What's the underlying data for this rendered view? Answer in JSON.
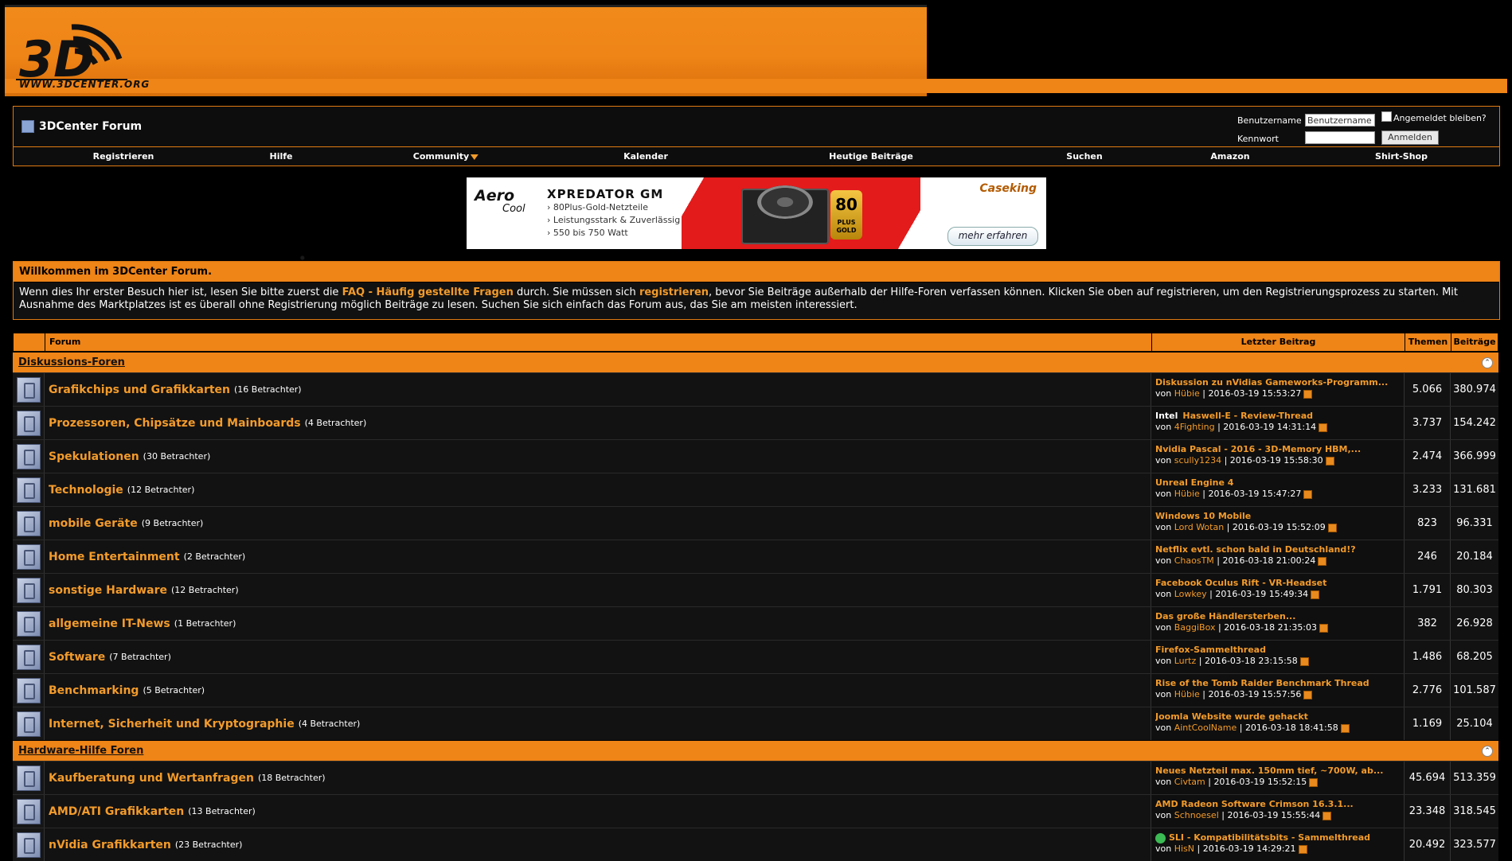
{
  "site": {
    "logo_text": "3D",
    "url": "WWW.3DCENTER.ORG",
    "title": "3DCenter Forum"
  },
  "login": {
    "username_label": "Benutzername",
    "username_placeholder": "Benutzername",
    "password_label": "Kennwort",
    "remember_label": "Angemeldet bleiben?",
    "login_button": "Anmelden"
  },
  "nav": {
    "items": [
      "Registrieren",
      "Hilfe",
      "Community",
      "Kalender",
      "Heutige Beiträge",
      "Suchen",
      "Amazon",
      "Shirt-Shop"
    ]
  },
  "banner": {
    "brand": "Aero",
    "brand2": "Cool",
    "product": "XPREDATOR GM",
    "bullets": [
      "80Plus-Gold-Netzteile",
      "Leistungsstark & Zuverlässig",
      "550 bis 750 Watt"
    ],
    "badge": "80",
    "badge_sub": "PLUS",
    "badge_sub2": "GOLD",
    "shop": "Caseking",
    "cta": "mehr erfahren"
  },
  "welcome": {
    "title": "Willkommen im 3DCenter Forum.",
    "text_1": "Wenn dies Ihr erster Besuch hier ist, lesen Sie bitte zuerst die ",
    "link_faq": "FAQ - Häufig gestellte Fragen",
    "text_2": " durch. Sie müssen sich ",
    "link_register": "registrieren",
    "text_3": ", bevor Sie Beiträge außerhalb der Hilfe-Foren verfassen können. Klicken Sie oben auf registrieren, um den Registrierungsprozess zu starten. Mit Ausnahme des Marktplatzes ist es überall ohne Registrierung möglich Beiträge zu lesen. Suchen Sie sich einfach das Forum aus, das Sie am meisten interessiert."
  },
  "table": {
    "headers": {
      "forum": "Forum",
      "last": "Letzter Beitrag",
      "threads": "Themen",
      "posts": "Beiträge"
    },
    "sections": [
      {
        "title": "Diskussions-Foren",
        "rows": [
          {
            "name": "Grafikchips und Grafikkarten",
            "viewers": "(16 Betrachter)",
            "last_title": "Diskussion zu nVidias Gameworks-Programm...",
            "prefix": "",
            "by": "von",
            "user": "Hübie",
            "date": "2016-03-19 15:53:27",
            "threads": "5.066",
            "posts": "380.974"
          },
          {
            "name": "Prozessoren, Chipsätze und Mainboards",
            "viewers": "(4 Betrachter)",
            "last_title": "Haswell-E - Review-Thread",
            "prefix": "Intel",
            "by": "von",
            "user": "4Fighting",
            "date": "2016-03-19 14:31:14",
            "threads": "3.737",
            "posts": "154.242"
          },
          {
            "name": "Spekulationen",
            "viewers": "(30 Betrachter)",
            "last_title": "Nvidia Pascal - 2016 - 3D-Memory HBM,...",
            "prefix": "",
            "by": "von",
            "user": "scully1234",
            "date": "2016-03-19 15:58:30",
            "threads": "2.474",
            "posts": "366.999"
          },
          {
            "name": "Technologie",
            "viewers": "(12 Betrachter)",
            "last_title": "Unreal Engine 4",
            "prefix": "",
            "by": "von",
            "user": "Hübie",
            "date": "2016-03-19 15:47:27",
            "threads": "3.233",
            "posts": "131.681"
          },
          {
            "name": "mobile Geräte",
            "viewers": "(9 Betrachter)",
            "last_title": "Windows 10 Mobile",
            "prefix": "",
            "by": "von",
            "user": "Lord Wotan",
            "date": "2016-03-19 15:52:09",
            "threads": "823",
            "posts": "96.331"
          },
          {
            "name": "Home Entertainment",
            "viewers": "(2 Betrachter)",
            "last_title": "Netflix evtl. schon bald in Deutschland!?",
            "prefix": "",
            "by": "von",
            "user": "ChaosTM",
            "date": "2016-03-18 21:00:24",
            "threads": "246",
            "posts": "20.184"
          },
          {
            "name": "sonstige Hardware",
            "viewers": "(12 Betrachter)",
            "last_title": "Facebook Oculus Rift - VR-Headset",
            "prefix": "",
            "by": "von",
            "user": "Lowkey",
            "date": "2016-03-19 15:49:34",
            "threads": "1.791",
            "posts": "80.303"
          },
          {
            "name": "allgemeine IT-News",
            "viewers": "(1 Betrachter)",
            "last_title": "Das große Händlersterben...",
            "prefix": "",
            "by": "von",
            "user": "BaggiBox",
            "date": "2016-03-18 21:35:03",
            "threads": "382",
            "posts": "26.928"
          },
          {
            "name": "Software",
            "viewers": "(7 Betrachter)",
            "last_title": "Firefox-Sammelthread",
            "prefix": "",
            "by": "von",
            "user": "Lurtz",
            "date": "2016-03-18 23:15:58",
            "threads": "1.486",
            "posts": "68.205"
          },
          {
            "name": "Benchmarking",
            "viewers": "(5 Betrachter)",
            "last_title": "Rise of the Tomb Raider Benchmark Thread",
            "prefix": "",
            "by": "von",
            "user": "Hübie",
            "date": "2016-03-19 15:57:56",
            "threads": "2.776",
            "posts": "101.587"
          },
          {
            "name": "Internet, Sicherheit und Kryptographie",
            "viewers": "(4 Betrachter)",
            "last_title": "Joomla Website wurde gehackt",
            "prefix": "",
            "by": "von",
            "user": "AintCoolName",
            "date": "2016-03-18 18:41:58",
            "threads": "1.169",
            "posts": "25.104"
          }
        ]
      },
      {
        "title": "Hardware-Hilfe Foren",
        "rows": [
          {
            "name": "Kaufberatung und Wertanfragen",
            "viewers": "(18 Betrachter)",
            "last_title": "Neues Netzteil max. 150mm tief, ~700W, ab...",
            "prefix": "",
            "by": "von",
            "user": "Civtam",
            "date": "2016-03-19 15:52:15",
            "threads": "45.694",
            "posts": "513.359"
          },
          {
            "name": "AMD/ATI Grafikkarten",
            "viewers": "(13 Betrachter)",
            "last_title": "AMD Radeon Software Crimson 16.3.1...",
            "prefix": "",
            "by": "von",
            "user": "Schnoesel",
            "date": "2016-03-19 15:55:44",
            "threads": "23.348",
            "posts": "318.545"
          },
          {
            "name": "nVidia Grafikkarten",
            "viewers": "(23 Betrachter)",
            "last_title": "SLI - Kompatibilitätsbits - Sammelthread",
            "prefix": "",
            "by": "von",
            "user": "HisN",
            "date": "2016-03-19 14:29:21",
            "threads": "20.492",
            "posts": "323.577"
          }
        ]
      }
    ]
  },
  "colors": {
    "accent": "#ef8417",
    "link": "#f39b2b",
    "bg": "#000000"
  }
}
